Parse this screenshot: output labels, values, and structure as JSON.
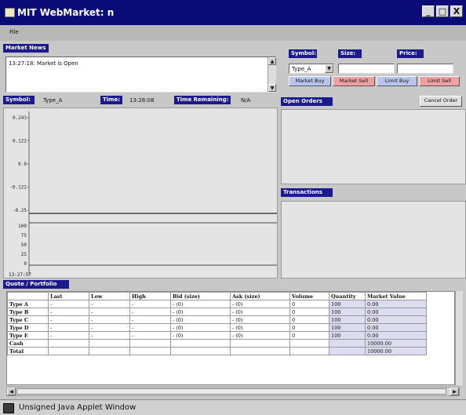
{
  "window": {
    "title": "MIT WebMarket: n",
    "min": "_",
    "max": "□",
    "close": "X"
  },
  "menu": {
    "file": "File"
  },
  "market_news": {
    "header": "Market News",
    "text": "13:27:18: Market is Open"
  },
  "order_entry": {
    "symbol_label": "Symbol:",
    "size_label": "Size:",
    "price_label": "Price:",
    "symbol_value": "Type_A",
    "size_value": "",
    "price_value": "",
    "buttons": [
      "Market Buy",
      "Market Sell",
      "Limit Buy",
      "Limit Sell"
    ]
  },
  "chart_info": {
    "symbol_label": "Symbol:",
    "symbol_value": "Type_A",
    "time_label": "Time:",
    "time_value": "13:28:08",
    "remaining_label": "Time Remaining:",
    "remaining_value": "N/A"
  },
  "chart_data": {
    "type": "line",
    "price_ticks": [
      "0.243",
      "0.122",
      "0.0",
      "-0.122",
      "-0.25"
    ],
    "volume_ticks": [
      "100",
      "75",
      "50",
      "25",
      "0"
    ],
    "time_label": "13:27:57",
    "series": []
  },
  "open_orders": {
    "header": "Open Orders",
    "cancel_label": "Cancel Order"
  },
  "transactions": {
    "header": "Transactions"
  },
  "quote_header": "Quote / Portfolio",
  "quote_table": {
    "columns": [
      "",
      "Last",
      "Low",
      "High",
      "Bid (size)",
      "Ask (size)",
      "Volume",
      "Quantity",
      "Market Value"
    ],
    "rows": [
      [
        "Type A",
        "-",
        "-",
        "-",
        "- (0)",
        "- (0)",
        "0",
        "100",
        "0.00"
      ],
      [
        "Type B",
        "-",
        "-",
        "-",
        "- (0)",
        "- (0)",
        "0",
        "100",
        "0.00"
      ],
      [
        "Type C",
        "-",
        "-",
        "-",
        "- (0)",
        "- (0)",
        "0",
        "100",
        "0.00"
      ],
      [
        "Type D",
        "-",
        "-",
        "-",
        "- (0)",
        "- (0)",
        "0",
        "100",
        "0.00"
      ],
      [
        "Type E",
        "-",
        "-",
        "-",
        "- (0)",
        "- (0)",
        "0",
        "100",
        "0.00"
      ],
      [
        "Cash",
        "",
        "",
        "",
        "",
        "",
        "",
        "",
        "10000.00"
      ],
      [
        "Total",
        "",
        "",
        "",
        "",
        "",
        "",
        "",
        "10000.00"
      ]
    ]
  },
  "status": {
    "text": "Unsigned Java Applet Window"
  }
}
